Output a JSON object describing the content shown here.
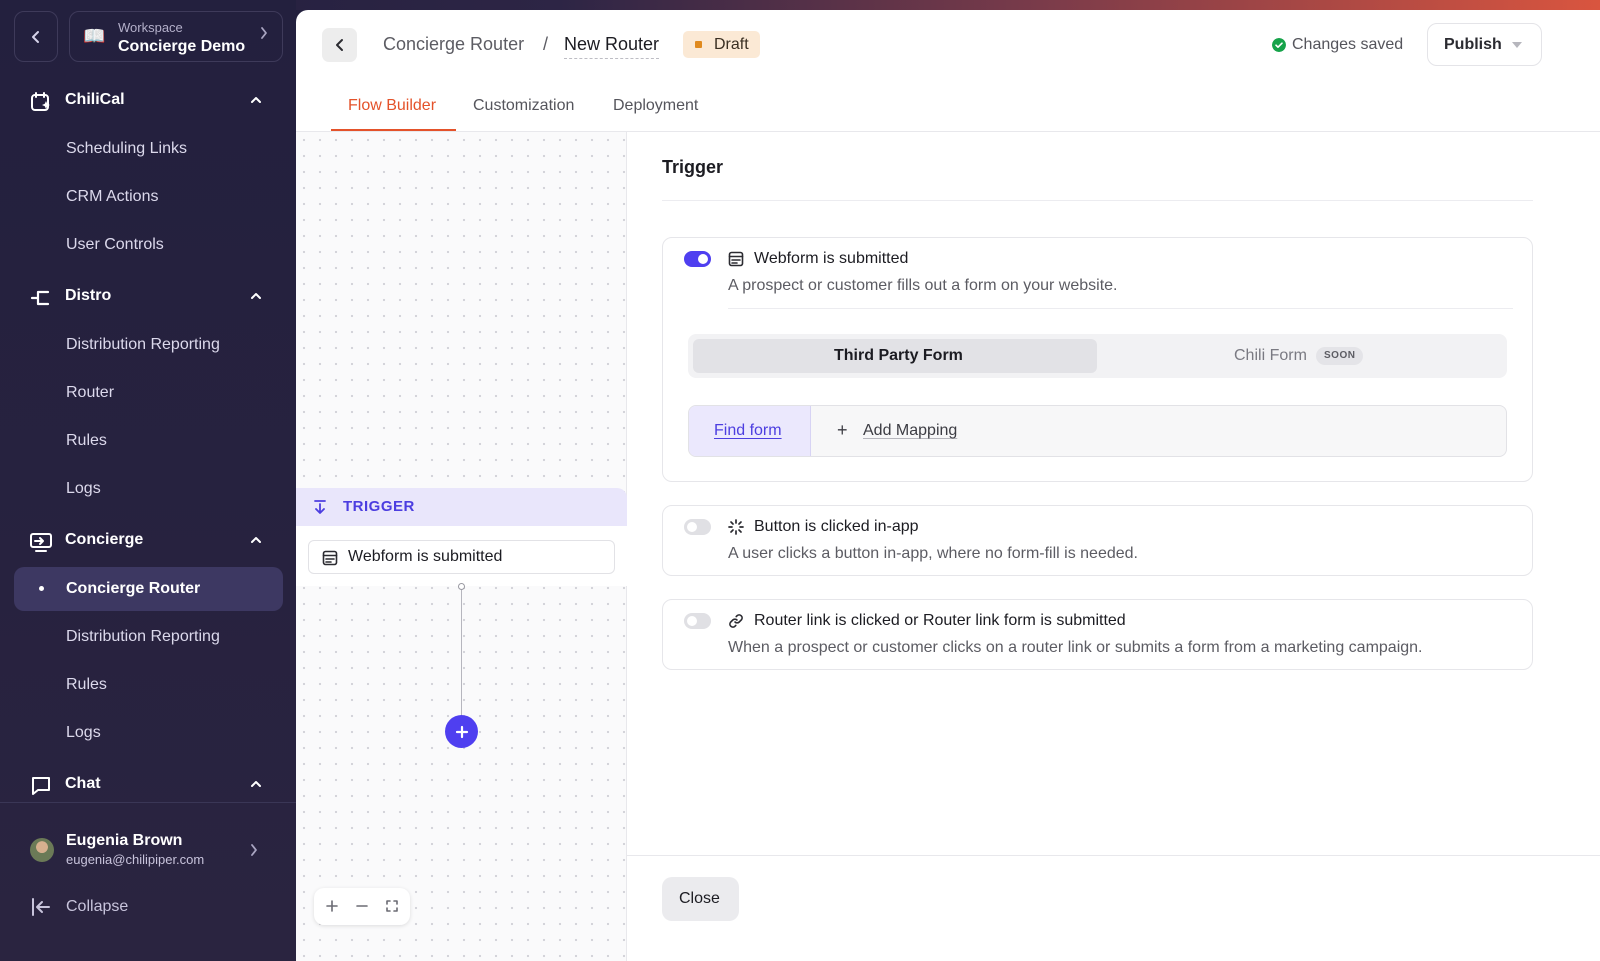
{
  "colors": {
    "accent": "#e4522a",
    "primary": "#4f3ff0",
    "sidebar": "#23203e",
    "saved": "#16a34a",
    "draft": "#e08a1e"
  },
  "workspace": {
    "label": "Workspace",
    "name": "Concierge Demo",
    "icon": "book-icon"
  },
  "sidebar": {
    "sections": [
      {
        "label": "ChiliCal",
        "icon": "calendar-sparkle-icon",
        "items": [
          "Scheduling Links",
          "CRM Actions",
          "User Controls"
        ]
      },
      {
        "label": "Distro",
        "icon": "distro-icon",
        "items": [
          "Distribution Reporting",
          "Router",
          "Rules",
          "Logs"
        ]
      },
      {
        "label": "Concierge",
        "icon": "concierge-icon",
        "items": [
          "Concierge Router",
          "Distribution Reporting",
          "Rules",
          "Logs"
        ],
        "active_item": "Concierge Router"
      },
      {
        "label": "Chat",
        "icon": "chat-icon",
        "items": []
      }
    ],
    "user": {
      "name": "Eugenia Brown",
      "email": "eugenia@chilipiper.com"
    },
    "collapse_label": "Collapse"
  },
  "header": {
    "breadcrumb_parent": "Concierge Router",
    "breadcrumb_sep": "/",
    "breadcrumb_current": "New Router",
    "status_badge": "Draft",
    "saved_status": "Changes saved",
    "publish_label": "Publish"
  },
  "tabs": [
    {
      "label": "Flow Builder",
      "active": true
    },
    {
      "label": "Customization",
      "active": false
    },
    {
      "label": "Deployment",
      "active": false
    }
  ],
  "canvas": {
    "trigger_label": "TRIGGER",
    "node_label": "Webform is submitted",
    "zoom_controls": [
      "plus-icon",
      "minus-icon",
      "fit-view-icon"
    ]
  },
  "panel": {
    "title": "Trigger",
    "options": [
      {
        "title": "Webform is submitted",
        "description": "A prospect or customer fills out a form on your website.",
        "enabled": true,
        "icon": "webform-icon",
        "segments": [
          "Third Party Form",
          "Chili Form"
        ],
        "selected_segment": "Third Party Form",
        "soon_badge": "SOON",
        "find_form_label": "Find form",
        "add_mapping_label": "Add Mapping"
      },
      {
        "title": "Button is clicked in-app",
        "description": "A user clicks a button in-app, where no form-fill is needed.",
        "enabled": false,
        "icon": "loader-icon"
      },
      {
        "title": "Router link is clicked or Router link form is submitted",
        "description": "When a prospect or customer clicks on a router link or submits a form from a marketing campaign.",
        "enabled": false,
        "icon": "link-icon"
      }
    ],
    "close_label": "Close"
  }
}
